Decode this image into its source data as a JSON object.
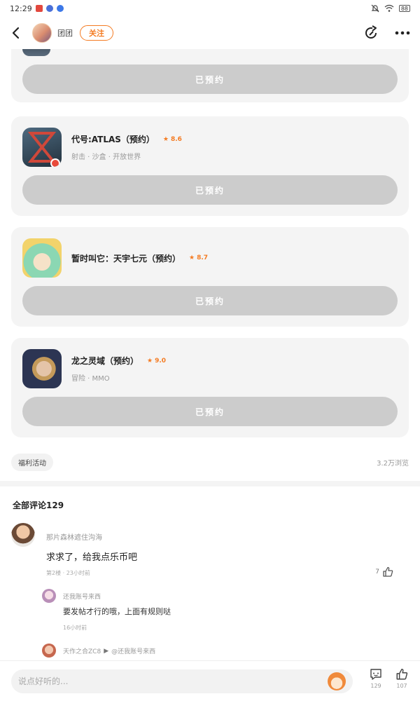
{
  "status_bar": {
    "time": "12:29",
    "battery": "88"
  },
  "header": {
    "author_name": "团团",
    "follow_label": "关注"
  },
  "games": [
    {
      "title": "代号:ATLAS（预约）",
      "rating": "8.6",
      "tags": "射击 · 沙盒 · 开放世界",
      "button_label": "已预约",
      "icon": "atlas-game-icon",
      "icon_colors": [
        "#3a5366",
        "#c94a3d"
      ]
    },
    {
      "title": "暂时叫它：天宇七元（预约）",
      "rating": "8.7",
      "tags": "",
      "button_label": "已预约",
      "icon": "anime-girl-game-icon",
      "icon_colors": [
        "#8bd7b3",
        "#f2d36b"
      ]
    },
    {
      "title": "龙之灵域（预约）",
      "rating": "9.0",
      "tags": "冒险 · MMO",
      "button_label": "已预约",
      "icon": "elf-game-icon",
      "icon_colors": [
        "#2c3553",
        "#d3b59a"
      ]
    }
  ],
  "top_card": {
    "button_label": "已预约"
  },
  "welfare": {
    "chip_label": "福利活动",
    "views": "3.2万浏览"
  },
  "comments": {
    "title": "全部评论129",
    "main": {
      "user": "那片森林遮住沟海",
      "body": "求求了，给我点乐币吧",
      "meta": "第2楼 · 23小时前",
      "likes": "7"
    },
    "reply": {
      "user": "还我账号来西",
      "body": "要发帖才行的哦，上面有规则哒",
      "meta": "16小时前"
    },
    "reply2": {
      "user": "天作之合ZC8",
      "arrow": "▶",
      "target": "@还我账号来西"
    }
  },
  "bottom_bar": {
    "placeholder": "说点好听的...",
    "comment_count": "129",
    "like_count": "107"
  },
  "colors": {
    "accent": "#f47b22",
    "button_gray": "#cccccc",
    "card_bg": "#f4f4f4"
  }
}
